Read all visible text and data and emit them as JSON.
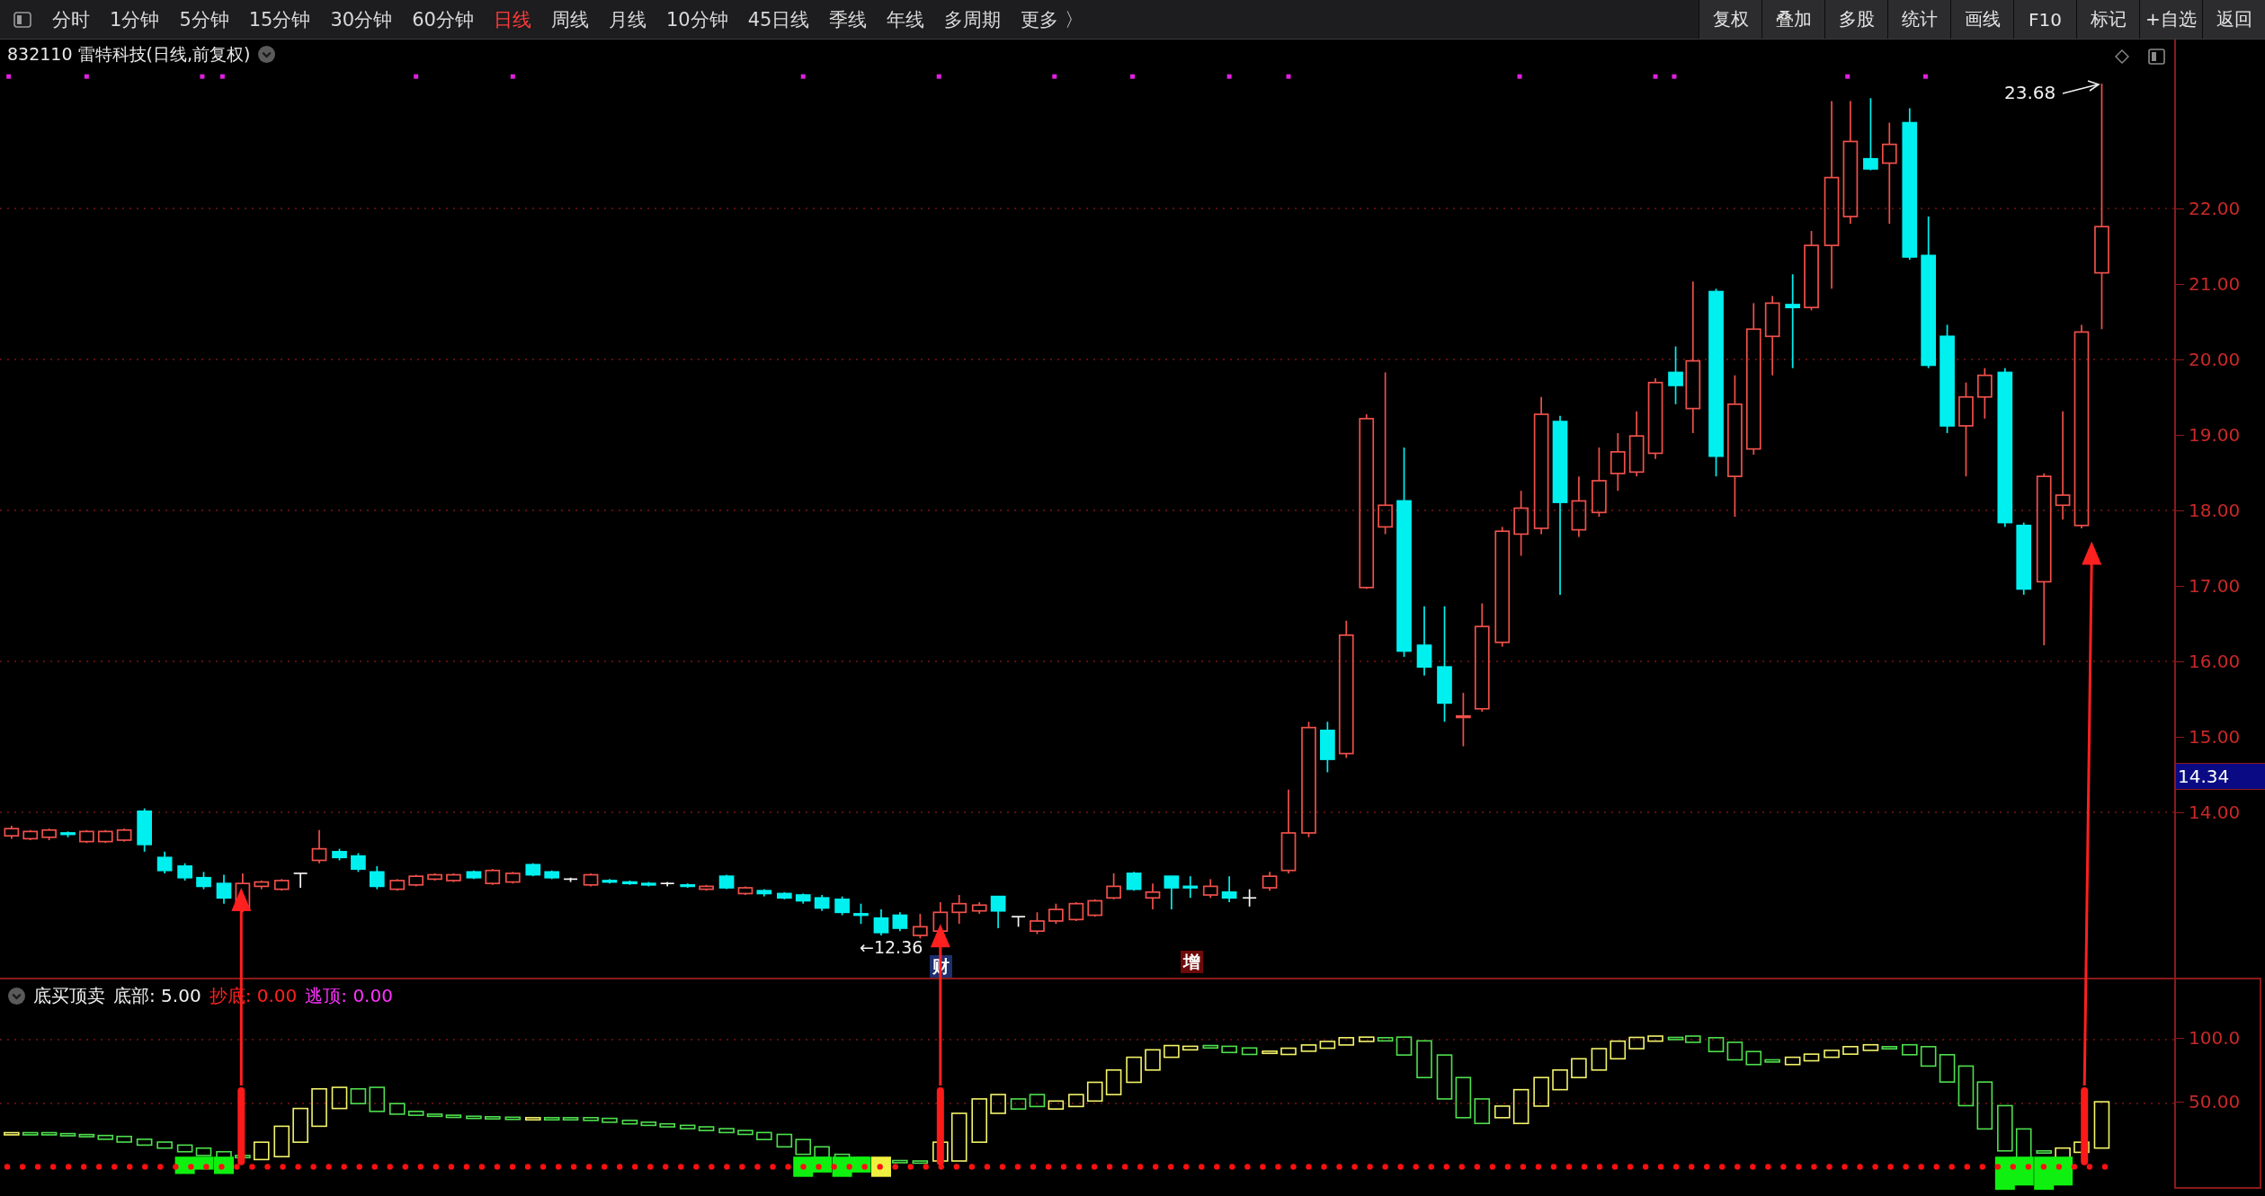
{
  "toolbar": {
    "period_tabs": [
      {
        "label": "分时",
        "selected": false
      },
      {
        "label": "1分钟",
        "selected": false
      },
      {
        "label": "5分钟",
        "selected": false
      },
      {
        "label": "15分钟",
        "selected": false
      },
      {
        "label": "30分钟",
        "selected": false
      },
      {
        "label": "60分钟",
        "selected": false
      },
      {
        "label": "日线",
        "selected": true
      },
      {
        "label": "周线",
        "selected": false
      },
      {
        "label": "月线",
        "selected": false
      },
      {
        "label": "10分钟",
        "selected": false
      },
      {
        "label": "45日线",
        "selected": false
      },
      {
        "label": "季线",
        "selected": false
      },
      {
        "label": "年线",
        "selected": false
      },
      {
        "label": "多周期",
        "selected": false
      },
      {
        "label": "更多 〉",
        "selected": false
      }
    ],
    "buttons": [
      "复权",
      "叠加",
      "多股",
      "统计",
      "画线",
      "F10",
      "标记",
      "+自选",
      "返回"
    ]
  },
  "price_chart": {
    "title": "832110 雷特科技(日线,前复权)",
    "high_label": "23.68",
    "low_label": "←12.36",
    "event_markers": [
      {
        "label": "财",
        "color": "#1c2f6e"
      },
      {
        "label": "增",
        "color": "#6e0a0a"
      }
    ],
    "y_axis_labels": [
      "22.00",
      "21.00",
      "20.00",
      "19.00",
      "18.00",
      "17.00",
      "16.00",
      "15.00",
      "14.00"
    ],
    "last_price": "14.34"
  },
  "indicator": {
    "name": "底买顶卖",
    "values": [
      {
        "label": "底部: 5.00",
        "color": "#f0f0f0"
      },
      {
        "label": "抄底: 0.00",
        "color": "#ff2020"
      },
      {
        "label": "逃顶: 0.00",
        "color": "#ff33ff"
      }
    ],
    "y_axis_labels": [
      "100.0",
      "50.00"
    ]
  }
}
